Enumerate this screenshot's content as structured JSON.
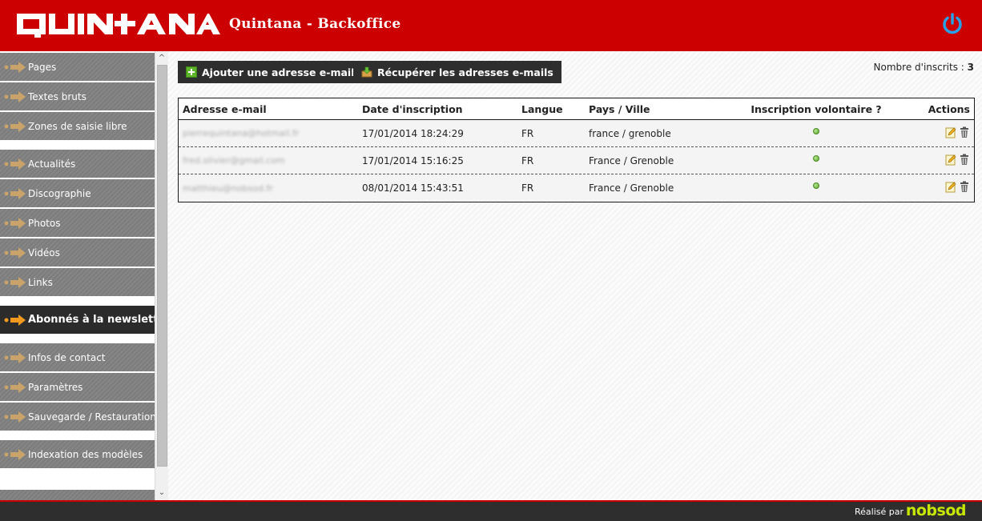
{
  "header": {
    "logo_text": "QUINTANA",
    "title": "Quintana - Backoffice",
    "accent_color": "#cc0000"
  },
  "sidebar": {
    "items": [
      {
        "label": "Pages",
        "icon": "arrow-right-icon",
        "active": false
      },
      {
        "label": "Textes bruts",
        "icon": "arrow-right-icon",
        "active": false
      },
      {
        "label": "Zones de saisie libre",
        "icon": "arrow-right-icon",
        "active": false
      },
      {
        "label": "Actualités",
        "icon": "arrow-right-icon",
        "active": false
      },
      {
        "label": "Discographie",
        "icon": "arrow-right-icon",
        "active": false
      },
      {
        "label": "Photos",
        "icon": "arrow-right-icon",
        "active": false
      },
      {
        "label": "Vidéos",
        "icon": "arrow-right-icon",
        "active": false
      },
      {
        "label": "Links",
        "icon": "arrow-right-icon",
        "active": false
      },
      {
        "label": "Abonnés à la newsletter",
        "icon": "arrow-right-icon",
        "active": true
      },
      {
        "label": "Infos de contact",
        "icon": "arrow-right-icon",
        "active": false
      },
      {
        "label": "Paramètres",
        "icon": "arrow-right-icon",
        "active": false
      },
      {
        "label": "Sauvegarde / Restauration",
        "icon": "arrow-right-icon",
        "active": false
      },
      {
        "label": "Indexation des modèles",
        "icon": "arrow-right-icon",
        "active": false
      }
    ]
  },
  "toolbar": {
    "add_label": "Ajouter une adresse e-mail",
    "export_label": "Récupérer les adresses e-mails",
    "count_label": "Nombre d'inscrits :",
    "count_value": "3"
  },
  "table": {
    "headers": [
      "Adresse e-mail",
      "Date d'inscription",
      "Langue",
      "Pays / Ville",
      "Inscription volontaire ?",
      "Actions"
    ],
    "rows": [
      {
        "email": "pierrequintana@hotmail.fr",
        "date": "17/01/2014 18:24:29",
        "lang": "FR",
        "location": "france / grenoble",
        "voluntary": true
      },
      {
        "email": "fred.olivier@gmail.com",
        "date": "17/01/2014 15:16:25",
        "lang": "FR",
        "location": "France / Grenoble",
        "voluntary": true
      },
      {
        "email": "matthieu@nobsod.fr",
        "date": "08/01/2014 15:43:51",
        "lang": "FR",
        "location": "France / Grenoble",
        "voluntary": true
      }
    ]
  },
  "footer": {
    "made_by": "Réalisé par",
    "brand": "nobsod",
    "brand_color": "#c7e600"
  }
}
